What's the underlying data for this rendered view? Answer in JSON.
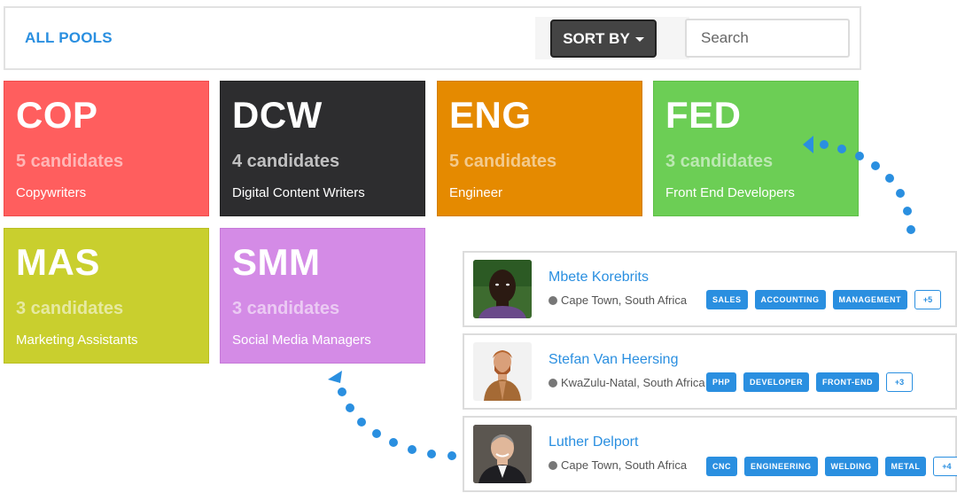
{
  "toolbar": {
    "all_pools": "ALL POOLS",
    "sort_label": "SORT BY",
    "search_placeholder": "Search"
  },
  "pools": [
    {
      "code": "COP",
      "count": "5 candidates",
      "name": "Copywriters",
      "color": "#ff5e5e"
    },
    {
      "code": "DCW",
      "count": "4 candidates",
      "name": "Digital Content Writers",
      "color": "#2d2d2f"
    },
    {
      "code": "ENG",
      "count": "5 candidates",
      "name": "Engineer",
      "color": "#e58a00"
    },
    {
      "code": "FED",
      "count": "3 candidates",
      "name": "Front End Developers",
      "color": "#6cce55"
    },
    {
      "code": "MAS",
      "count": "3 candidates",
      "name": "Marketing Assistants",
      "color": "#c9cf2e"
    },
    {
      "code": "SMM",
      "count": "3 candidates",
      "name": "Social Media Managers",
      "color": "#d48be6"
    }
  ],
  "candidates": [
    {
      "name": "Mbete Korebrits",
      "location": "Cape Town, South Africa",
      "tags": [
        "SALES",
        "ACCOUNTING",
        "MANAGEMENT"
      ],
      "more": "+5"
    },
    {
      "name": "Stefan Van Heersing",
      "location": "KwaZulu-Natal, South Africa",
      "tags": [
        "PHP",
        "DEVELOPER",
        "FRONT-END"
      ],
      "more": "+3"
    },
    {
      "name": "Luther Delport",
      "location": "Cape Town, South Africa",
      "tags": [
        "CNC",
        "ENGINEERING",
        "WELDING",
        "METAL"
      ],
      "more": "+4"
    }
  ],
  "icons": {
    "location": "globe-icon",
    "sort": "caret-down-icon"
  },
  "accent_color": "#2a8fe0"
}
